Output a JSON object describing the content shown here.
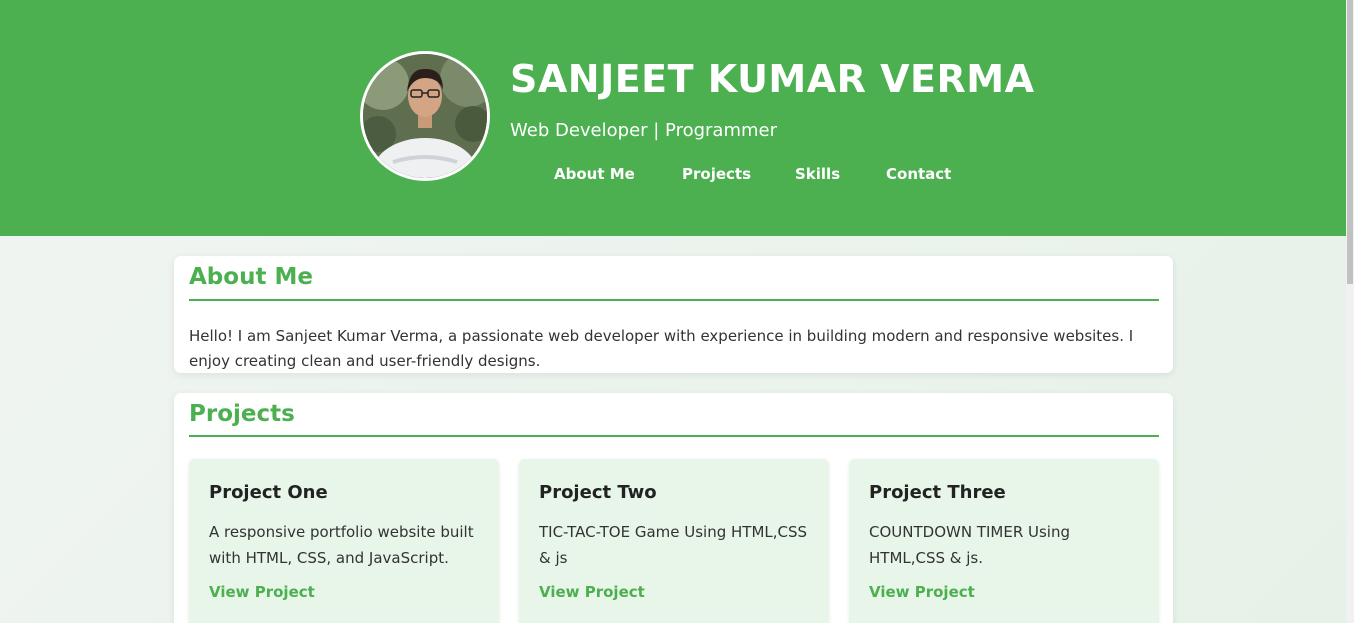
{
  "header": {
    "name": "SANJEET KUMAR VERMA",
    "tagline": "Web Developer | Programmer",
    "nav": [
      "About Me",
      "Projects",
      "Skills",
      "Contact"
    ]
  },
  "about": {
    "title": "About Me",
    "text": "Hello! I am Sanjeet Kumar Verma, a passionate web developer with experience in building modern and responsive websites. I enjoy creating clean and user-friendly designs."
  },
  "projects": {
    "title": "Projects",
    "items": [
      {
        "title": "Project One",
        "description": "A responsive portfolio website built with HTML, CSS, and JavaScript.",
        "link": "View Project"
      },
      {
        "title": "Project Two",
        "description": "TIC-TAC-TOE Game Using HTML,CSS & js",
        "link": "View Project"
      },
      {
        "title": "Project Three",
        "description": "COUNTDOWN TIMER Using HTML,CSS & js.",
        "link": "View Project"
      }
    ]
  },
  "colors": {
    "accent": "#4caf50",
    "card_background": "#ffffff",
    "project_background": "#e8f5e9"
  }
}
